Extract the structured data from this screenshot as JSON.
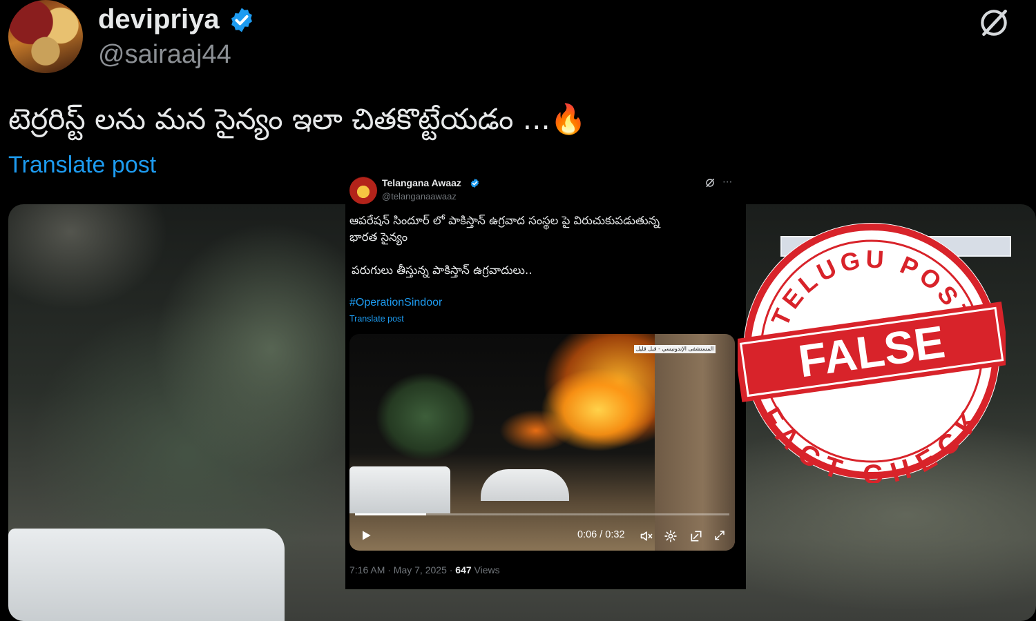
{
  "outer_tweet": {
    "display_name": "devipriya",
    "handle": "@sairaaj44",
    "text": "టెర్రరిస్ట్ లను మన సైన్యం ఇలా చితకొట్టేయడం ...🔥",
    "translate_label": "Translate post",
    "icons": {
      "verified": "verified-badge-icon",
      "grok": "grok-icon"
    },
    "accent_color": "#1d9bf0"
  },
  "inner_tweet": {
    "display_name": "Telangana Awaaz",
    "handle": "@telanganaawaaz",
    "more_label": "···",
    "text_line1": "ఆపరేషన్ సిందూర్ లో పాకిస్తాన్ ఉగ్రవాద సంస్థల పై విరుచుకుపడుతున్న",
    "text_line2": "భారత సైన్యం",
    "text_line3": "పరుగులు తీస్తున్న పాకిస్తాన్ ఉగ్రవాదులు..",
    "hashtag": "#OperationSindoor",
    "translate_label": "Translate post",
    "video": {
      "channel_label": "المستشفى الإندونيسي - قبل قليل",
      "current_time": "0:06",
      "duration": "0:32",
      "time_display": "0:06 / 0:32",
      "progress_fraction": 0.19,
      "controls": [
        "play-icon",
        "mute-icon",
        "settings-icon",
        "pip-icon",
        "fullscreen-icon"
      ]
    },
    "timestamp": "7:16 AM · May 7, 2025 · ",
    "views_count": "647",
    "views_label": " Views"
  },
  "stamp": {
    "top_text": "TELUGU POST",
    "center_text": "FALSE",
    "bottom_text": "FACT CHECK",
    "color": "#d8232a"
  }
}
